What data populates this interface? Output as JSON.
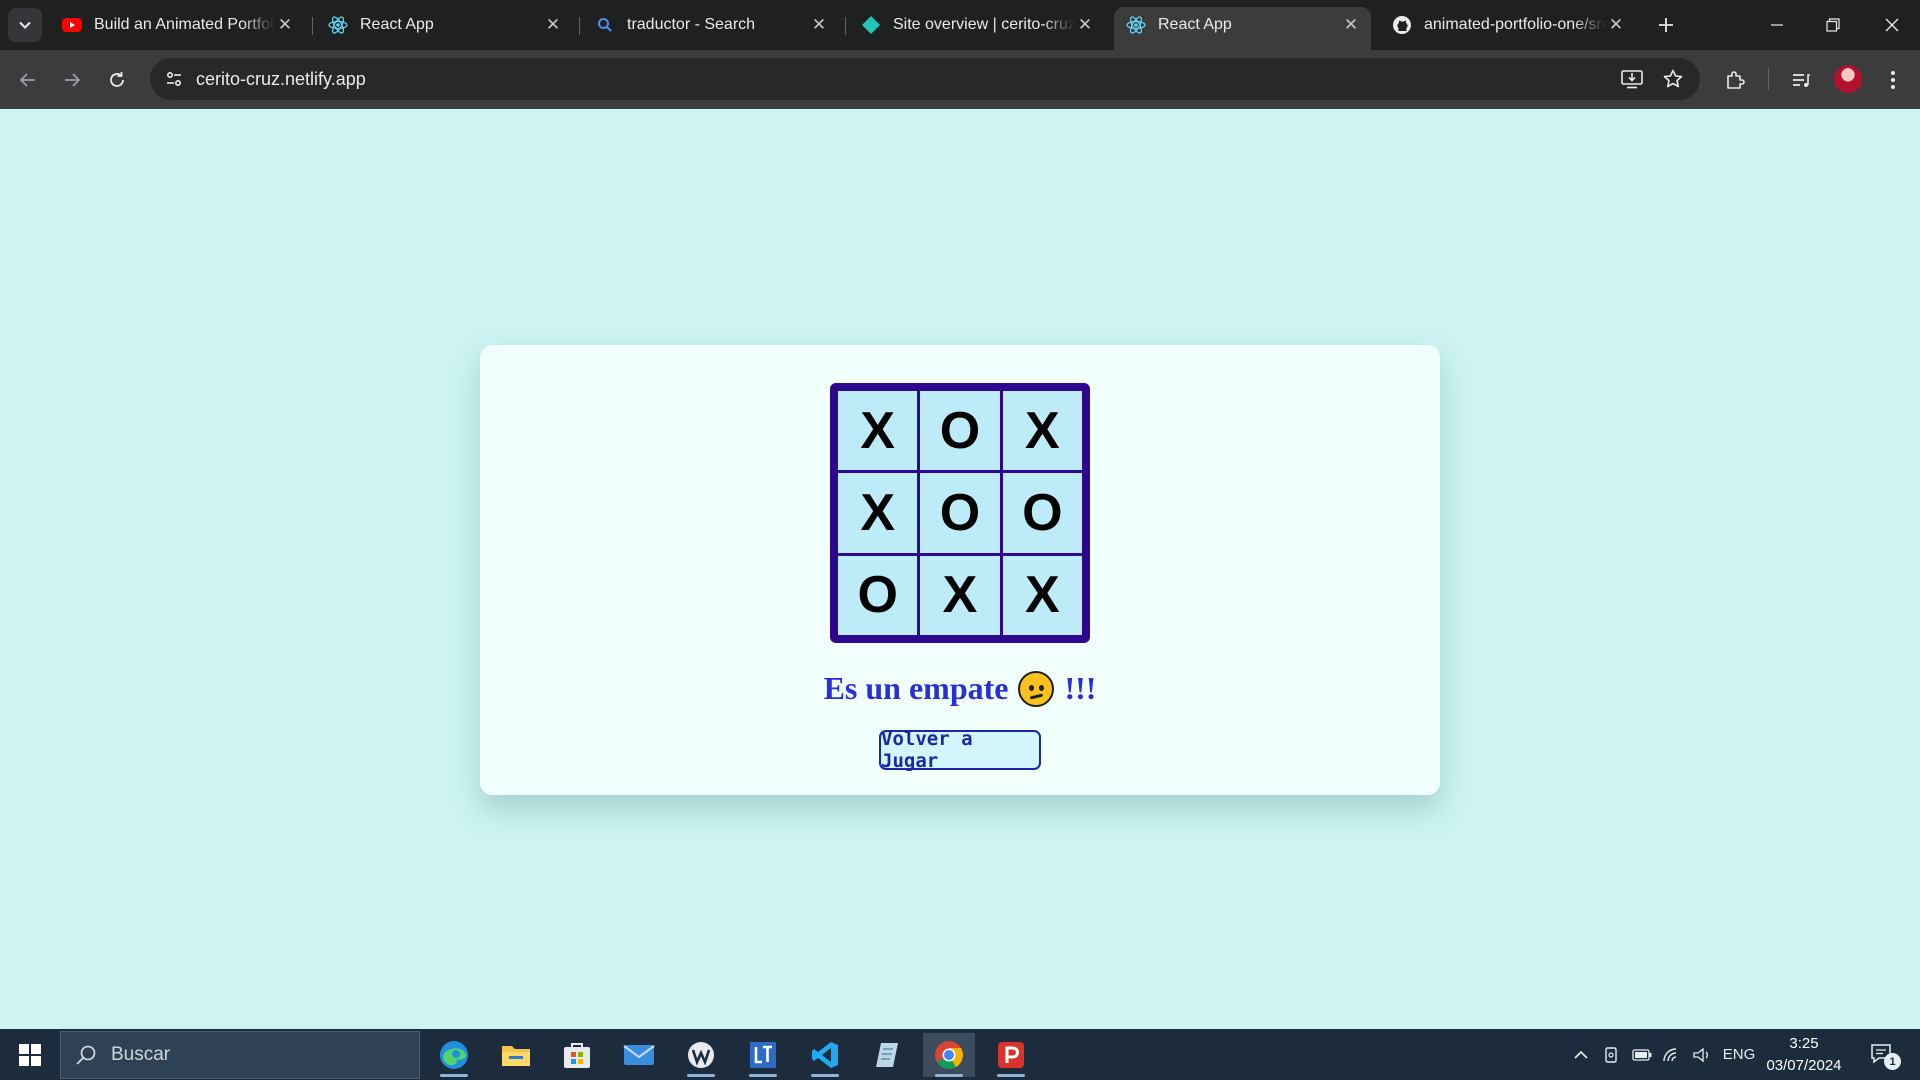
{
  "browser": {
    "tabs": [
      {
        "title": "Build an Animated Portfolio",
        "icon": "youtube-icon"
      },
      {
        "title": "React App",
        "icon": "react-icon"
      },
      {
        "title": "traductor - Search",
        "icon": "search-icon"
      },
      {
        "title": "Site overview | cerito-cruz |",
        "icon": "netlify-icon"
      },
      {
        "title": "React App",
        "icon": "react-icon",
        "active": true
      },
      {
        "title": "animated-portfolio-one/src",
        "icon": "github-icon"
      }
    ],
    "address": "cerito-cruz.netlify.app"
  },
  "game": {
    "board": [
      "X",
      "O",
      "X",
      "X",
      "O",
      "O",
      "O",
      "X",
      "X"
    ],
    "status_text": "Es un empate",
    "status_suffix": "!!!",
    "replay_label": "Volver a Jugar",
    "colors": {
      "board_border": "#2d078e",
      "cell": "#bdebf8",
      "status": "#2a2fd6",
      "page_bg": "#cdf4f2"
    }
  },
  "taskbar": {
    "search_placeholder": "Buscar",
    "language": "ENG",
    "time": "3:25",
    "date": "03/07/2024",
    "notification_count": "1"
  }
}
